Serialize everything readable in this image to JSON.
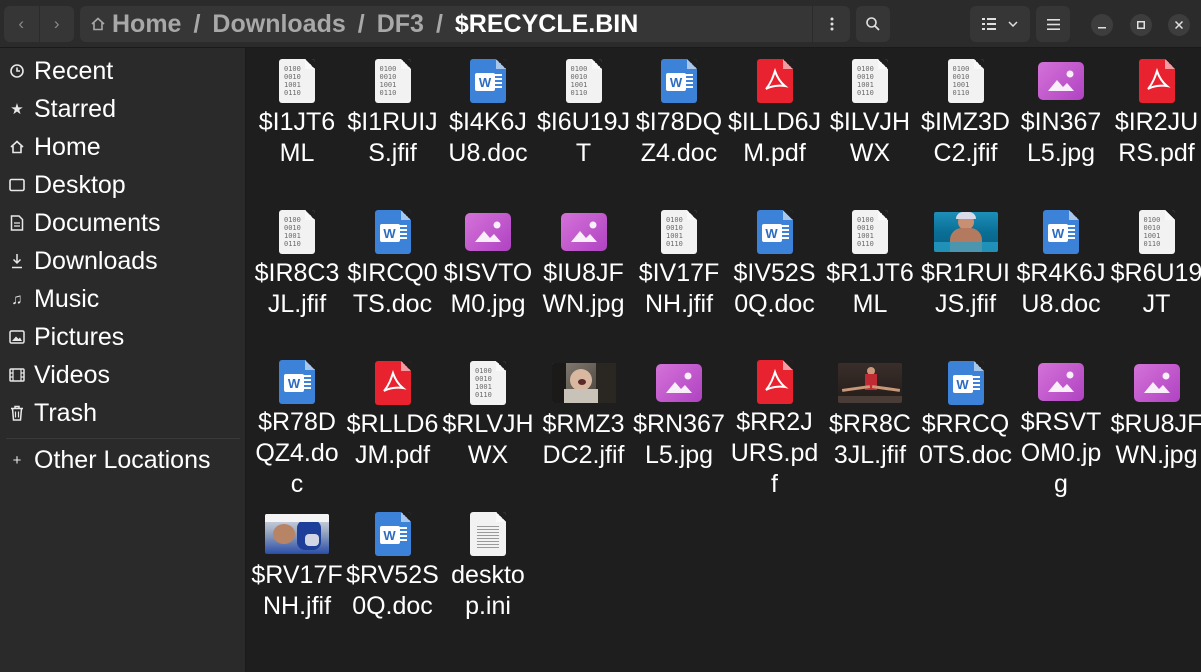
{
  "path": {
    "home_label": "Home",
    "segments": [
      "Downloads",
      "DF3"
    ],
    "current": "$RECYCLE.BIN",
    "separator": "/"
  },
  "sidebar": {
    "items": [
      {
        "label": "Recent",
        "icon": "clock-icon"
      },
      {
        "label": "Starred",
        "icon": "star-icon"
      },
      {
        "label": "Home",
        "icon": "home-icon"
      },
      {
        "label": "Desktop",
        "icon": "desktop-icon"
      },
      {
        "label": "Documents",
        "icon": "document-icon"
      },
      {
        "label": "Downloads",
        "icon": "download-icon"
      },
      {
        "label": "Music",
        "icon": "music-icon"
      },
      {
        "label": "Pictures",
        "icon": "pictures-icon"
      },
      {
        "label": "Videos",
        "icon": "video-icon"
      },
      {
        "label": "Trash",
        "icon": "trash-icon"
      }
    ],
    "other_locations": {
      "label": "Other Locations",
      "icon": "plus-icon"
    }
  },
  "files": [
    {
      "name": "$I1JT6ML",
      "type": "bin"
    },
    {
      "name": "$I1RUIJS.jfif",
      "type": "bin"
    },
    {
      "name": "$I4K6JU8.doc",
      "type": "word"
    },
    {
      "name": "$I6U19JT",
      "type": "bin"
    },
    {
      "name": "$I78DQZ4.doc",
      "type": "word"
    },
    {
      "name": "$ILLD6JM.pdf",
      "type": "pdf"
    },
    {
      "name": "$ILVJHWX",
      "type": "bin"
    },
    {
      "name": "$IMZ3DC2.jfif",
      "type": "bin"
    },
    {
      "name": "$IN367L5.jpg",
      "type": "image"
    },
    {
      "name": "$IR2JURS.pdf",
      "type": "pdf"
    },
    {
      "name": "$IR8C3JL.jfif",
      "type": "bin"
    },
    {
      "name": "$IRCQ0TS.doc",
      "type": "word"
    },
    {
      "name": "$ISVTOM0.jpg",
      "type": "image"
    },
    {
      "name": "$IU8JFWN.jpg",
      "type": "image"
    },
    {
      "name": "$IV17FNH.jfif",
      "type": "bin"
    },
    {
      "name": "$IV52S0Q.doc",
      "type": "word"
    },
    {
      "name": "$R1JT6ML",
      "type": "bin"
    },
    {
      "name": "$R1RUIJS.jfif",
      "type": "thumb-pool"
    },
    {
      "name": "$R4K6JU8.doc",
      "type": "word"
    },
    {
      "name": "$R6U19JT",
      "type": "bin"
    },
    {
      "name": "$R78DQZ4.doc",
      "type": "word"
    },
    {
      "name": "$RLLD6JM.pdf",
      "type": "pdf"
    },
    {
      "name": "$RLVJHWX",
      "type": "bin"
    },
    {
      "name": "$RMZ3DC2.jfif",
      "type": "thumb-car"
    },
    {
      "name": "$RN367L5.jpg",
      "type": "image"
    },
    {
      "name": "$RR2JURS.pdf",
      "type": "pdf"
    },
    {
      "name": "$RR8C3JL.jfif",
      "type": "thumb-gym"
    },
    {
      "name": "$RRCQ0TS.doc",
      "type": "word"
    },
    {
      "name": "$RSVTOM0.jpg",
      "type": "image"
    },
    {
      "name": "$RU8JFWN.jpg",
      "type": "image"
    },
    {
      "name": "$RV17FNH.jfif",
      "type": "thumb-fight"
    },
    {
      "name": "$RV52S0Q.doc",
      "type": "word"
    },
    {
      "name": "desktop.ini",
      "type": "text"
    }
  ],
  "colors": {
    "header_bg": "#2b2b2b",
    "sidebar_bg": "#2a2a2a",
    "content_bg": "#1e1e1e",
    "word_blue": "#3b82d8",
    "pdf_red": "#e8222e",
    "image_purple": "#c45acb"
  }
}
